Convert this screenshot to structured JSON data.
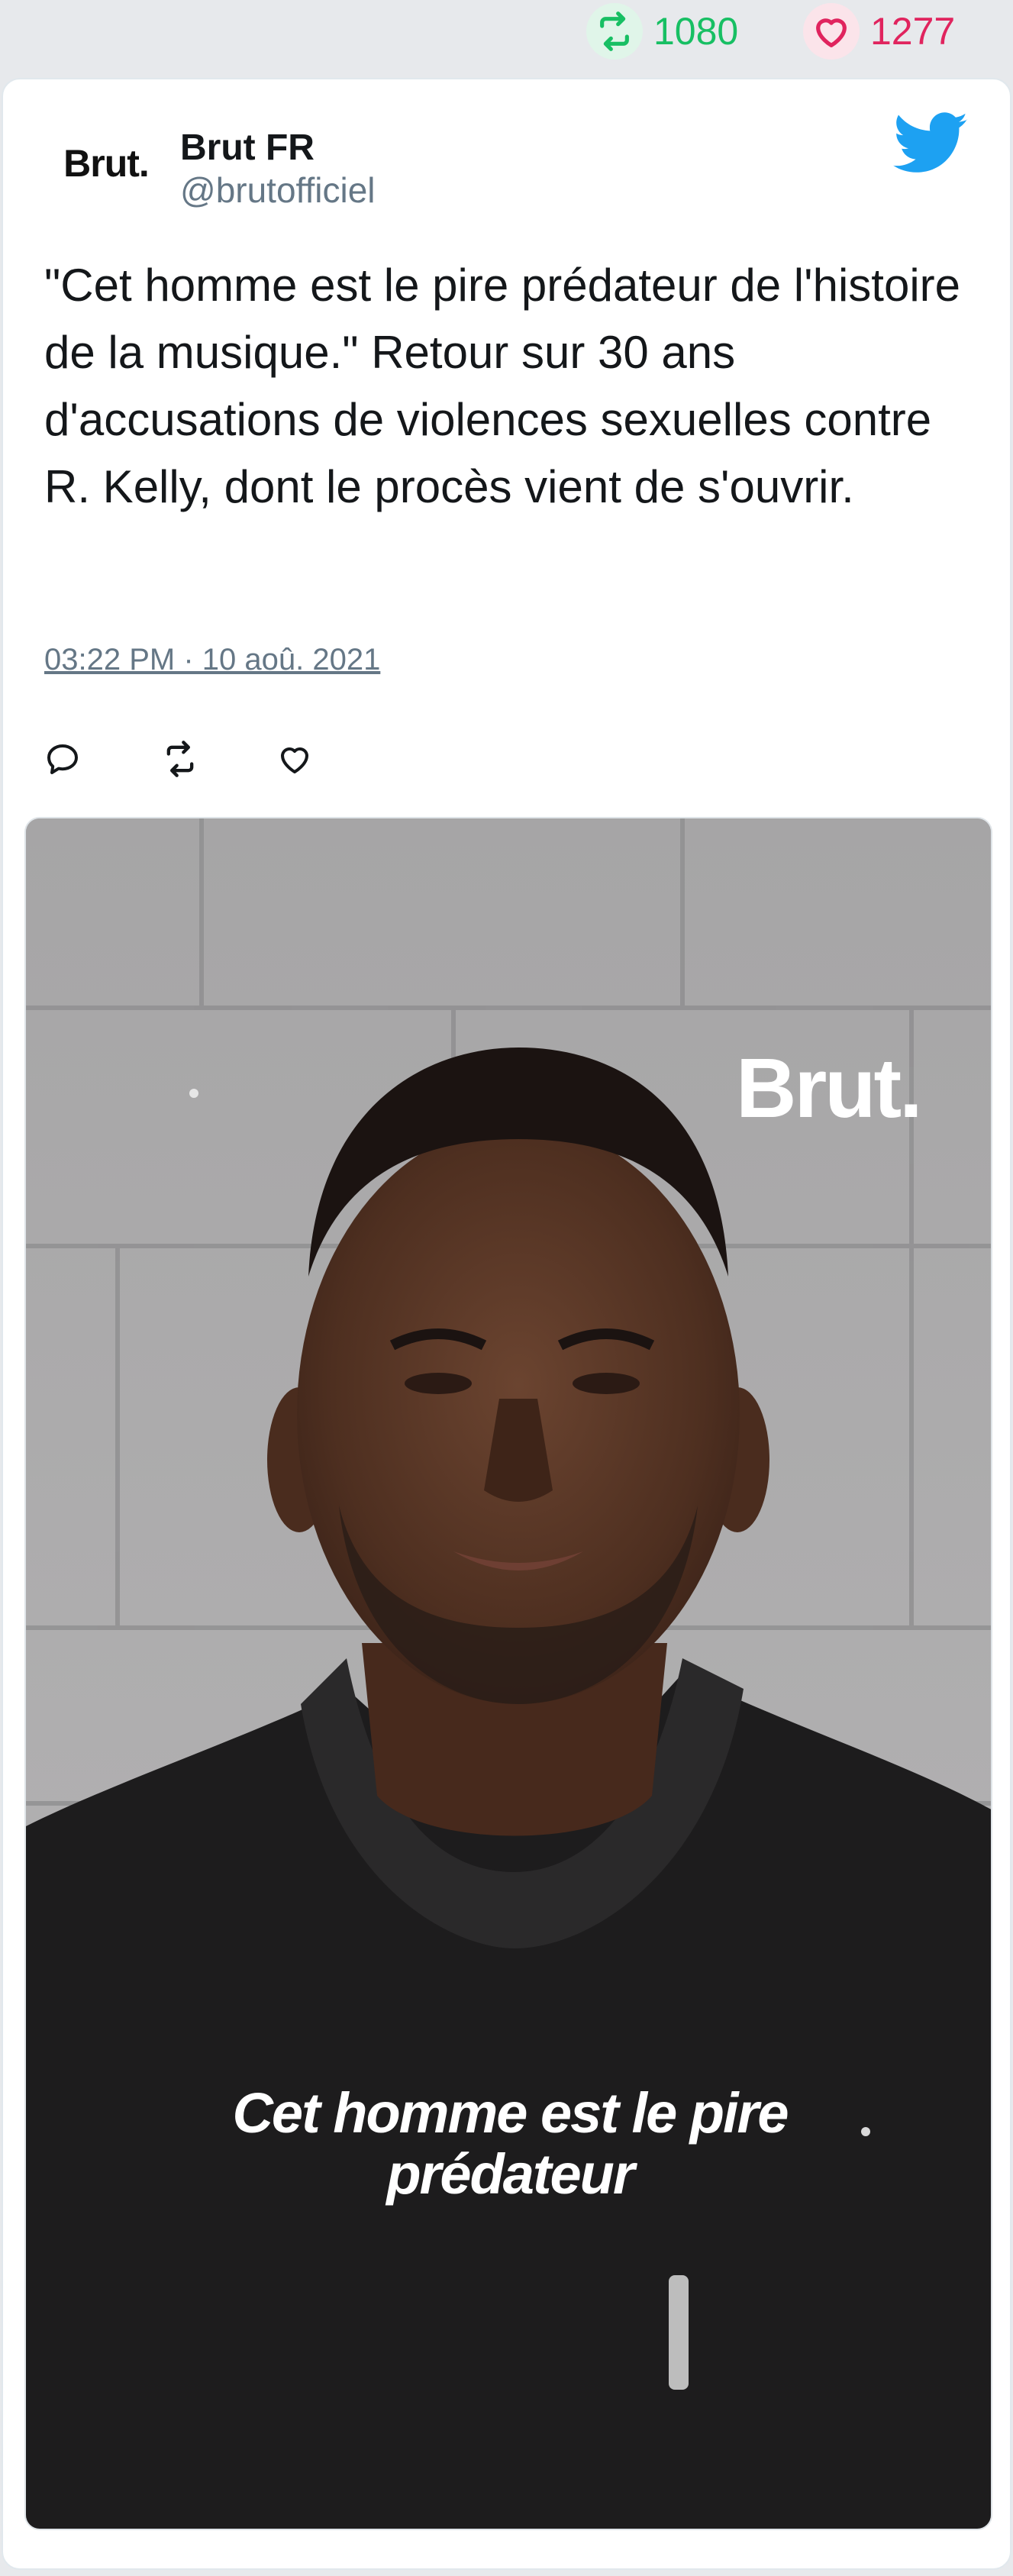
{
  "stats": {
    "retweets": "1080",
    "likes": "1277"
  },
  "tweet": {
    "avatar_text": "Brut.",
    "name": "Brut FR",
    "handle": "@brutofficiel",
    "text": "\"Cet homme est le pire prédateur de l'histoire de la musique.\" Retour sur 30 ans d'accusations de violences sexuelles contre R. Kelly, dont le procès vient de s'ouvrir.",
    "timestamp": "03:22 PM · 10 aoû. 2021"
  },
  "media": {
    "logo": "Brut.",
    "caption_line1": "Cet homme est le pire",
    "caption_line2": "prédateur"
  },
  "colors": {
    "retweet": "#17bf63",
    "like": "#e0245e",
    "twitter_blue": "#1da1f2",
    "muted": "#657786"
  },
  "icons": [
    "retweet-icon",
    "heart-icon",
    "twitter-bird-icon",
    "reply-icon"
  ]
}
